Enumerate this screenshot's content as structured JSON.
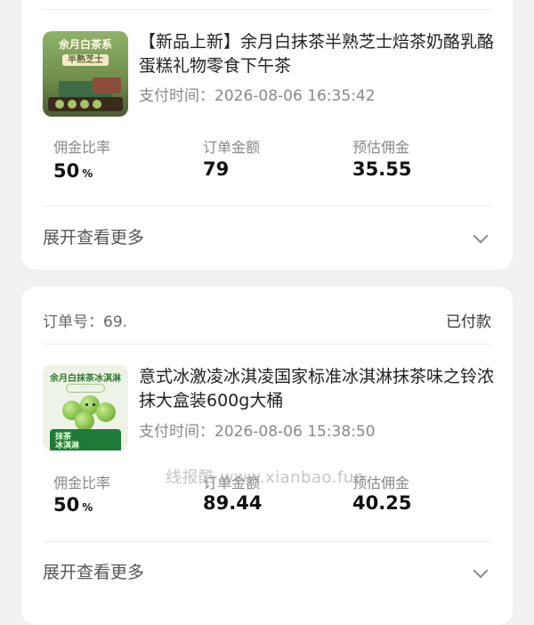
{
  "orders": [
    {
      "title": "【新品上新】余月白抹茶半熟芝士焙茶奶酪乳酪蛋糕礼物零食下午茶",
      "pay_time": "支付时间：2026-08-06 16:35:42",
      "thumb_title": "余月白茶系",
      "thumb_sub": "半熟芝士",
      "metrics": [
        {
          "label": "佣金比率",
          "value": "50",
          "unit": "%"
        },
        {
          "label": "订单金额",
          "value": "79"
        },
        {
          "label": "预估佣金",
          "value": "35.55"
        }
      ],
      "expand_label": "展开查看更多"
    },
    {
      "order_no": "订单号：69.",
      "status": "已付款",
      "title": "意式冰激凌冰淇凌国家标准冰淇淋抹茶味之铃浓抹大盒装600g大桶",
      "pay_time": "支付时间：2026-08-06 15:38:50",
      "thumb_title": "余月白抹茶冰淇淋",
      "thumb_tub": "抹茶\n冰淇淋",
      "metrics": [
        {
          "label": "佣金比率",
          "value": "50",
          "unit": "%"
        },
        {
          "label": "订单金额",
          "value": "89.44"
        },
        {
          "label": "预估佣金",
          "value": "40.25"
        }
      ],
      "expand_label": "展开查看更多"
    }
  ],
  "watermark": "线报酷 www.xianbao.fun",
  "icons": {
    "expand": "chevron-down-icon"
  }
}
